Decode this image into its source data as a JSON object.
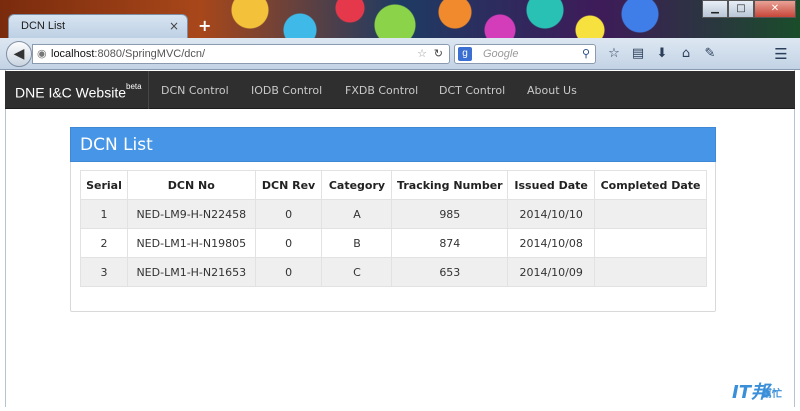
{
  "browser": {
    "tab_title": "DCN List",
    "tab_close": "×",
    "new_tab": "+",
    "window_buttons": {
      "minimize": "▁",
      "maximize": "□",
      "close": "✕"
    },
    "url_host": "localhost",
    "url_rest": ":8080/SpringMVC/dcn/",
    "search_placeholder": "Google",
    "back_glyph": "◀",
    "icons": [
      "star-icon",
      "bookmarks-icon",
      "download-icon",
      "home-icon",
      "addons-icon",
      "menu-icon"
    ]
  },
  "site": {
    "brand": "DNE I&C Website",
    "brand_sup": "beta",
    "nav": [
      {
        "label": "DCN Control"
      },
      {
        "label": "IODB Control"
      },
      {
        "label": "FXDB Control"
      },
      {
        "label": "DCT Control"
      },
      {
        "label": "About Us"
      }
    ]
  },
  "panel": {
    "title": "DCN List",
    "color": "#4795e6"
  },
  "table": {
    "headers": [
      "Serial",
      "DCN No",
      "DCN Rev",
      "Category",
      "Tracking Number",
      "Issued Date",
      "Completed Date"
    ],
    "rows": [
      [
        "1",
        "NED-LM9-H-N22458",
        "0",
        "A",
        "985",
        "2014/10/10",
        ""
      ],
      [
        "2",
        "NED-LM1-H-N19805",
        "0",
        "B",
        "874",
        "2014/10/08",
        ""
      ],
      [
        "3",
        "NED-LM1-H-N21653",
        "0",
        "C",
        "653",
        "2014/10/09",
        ""
      ]
    ]
  },
  "watermark": {
    "main": "IT邦",
    "sub": "幫忙"
  }
}
